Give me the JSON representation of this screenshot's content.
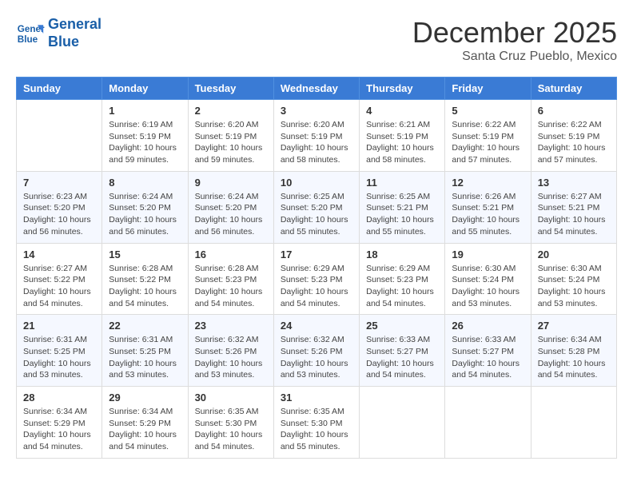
{
  "logo": {
    "line1": "General",
    "line2": "Blue"
  },
  "title": "December 2025",
  "location": "Santa Cruz Pueblo, Mexico",
  "days_header": [
    "Sunday",
    "Monday",
    "Tuesday",
    "Wednesday",
    "Thursday",
    "Friday",
    "Saturday"
  ],
  "weeks": [
    [
      {
        "num": "",
        "info": ""
      },
      {
        "num": "1",
        "info": "Sunrise: 6:19 AM\nSunset: 5:19 PM\nDaylight: 10 hours\nand 59 minutes."
      },
      {
        "num": "2",
        "info": "Sunrise: 6:20 AM\nSunset: 5:19 PM\nDaylight: 10 hours\nand 59 minutes."
      },
      {
        "num": "3",
        "info": "Sunrise: 6:20 AM\nSunset: 5:19 PM\nDaylight: 10 hours\nand 58 minutes."
      },
      {
        "num": "4",
        "info": "Sunrise: 6:21 AM\nSunset: 5:19 PM\nDaylight: 10 hours\nand 58 minutes."
      },
      {
        "num": "5",
        "info": "Sunrise: 6:22 AM\nSunset: 5:19 PM\nDaylight: 10 hours\nand 57 minutes."
      },
      {
        "num": "6",
        "info": "Sunrise: 6:22 AM\nSunset: 5:19 PM\nDaylight: 10 hours\nand 57 minutes."
      }
    ],
    [
      {
        "num": "7",
        "info": "Sunrise: 6:23 AM\nSunset: 5:20 PM\nDaylight: 10 hours\nand 56 minutes."
      },
      {
        "num": "8",
        "info": "Sunrise: 6:24 AM\nSunset: 5:20 PM\nDaylight: 10 hours\nand 56 minutes."
      },
      {
        "num": "9",
        "info": "Sunrise: 6:24 AM\nSunset: 5:20 PM\nDaylight: 10 hours\nand 56 minutes."
      },
      {
        "num": "10",
        "info": "Sunrise: 6:25 AM\nSunset: 5:20 PM\nDaylight: 10 hours\nand 55 minutes."
      },
      {
        "num": "11",
        "info": "Sunrise: 6:25 AM\nSunset: 5:21 PM\nDaylight: 10 hours\nand 55 minutes."
      },
      {
        "num": "12",
        "info": "Sunrise: 6:26 AM\nSunset: 5:21 PM\nDaylight: 10 hours\nand 55 minutes."
      },
      {
        "num": "13",
        "info": "Sunrise: 6:27 AM\nSunset: 5:21 PM\nDaylight: 10 hours\nand 54 minutes."
      }
    ],
    [
      {
        "num": "14",
        "info": "Sunrise: 6:27 AM\nSunset: 5:22 PM\nDaylight: 10 hours\nand 54 minutes."
      },
      {
        "num": "15",
        "info": "Sunrise: 6:28 AM\nSunset: 5:22 PM\nDaylight: 10 hours\nand 54 minutes."
      },
      {
        "num": "16",
        "info": "Sunrise: 6:28 AM\nSunset: 5:23 PM\nDaylight: 10 hours\nand 54 minutes."
      },
      {
        "num": "17",
        "info": "Sunrise: 6:29 AM\nSunset: 5:23 PM\nDaylight: 10 hours\nand 54 minutes."
      },
      {
        "num": "18",
        "info": "Sunrise: 6:29 AM\nSunset: 5:23 PM\nDaylight: 10 hours\nand 54 minutes."
      },
      {
        "num": "19",
        "info": "Sunrise: 6:30 AM\nSunset: 5:24 PM\nDaylight: 10 hours\nand 53 minutes."
      },
      {
        "num": "20",
        "info": "Sunrise: 6:30 AM\nSunset: 5:24 PM\nDaylight: 10 hours\nand 53 minutes."
      }
    ],
    [
      {
        "num": "21",
        "info": "Sunrise: 6:31 AM\nSunset: 5:25 PM\nDaylight: 10 hours\nand 53 minutes."
      },
      {
        "num": "22",
        "info": "Sunrise: 6:31 AM\nSunset: 5:25 PM\nDaylight: 10 hours\nand 53 minutes."
      },
      {
        "num": "23",
        "info": "Sunrise: 6:32 AM\nSunset: 5:26 PM\nDaylight: 10 hours\nand 53 minutes."
      },
      {
        "num": "24",
        "info": "Sunrise: 6:32 AM\nSunset: 5:26 PM\nDaylight: 10 hours\nand 53 minutes."
      },
      {
        "num": "25",
        "info": "Sunrise: 6:33 AM\nSunset: 5:27 PM\nDaylight: 10 hours\nand 54 minutes."
      },
      {
        "num": "26",
        "info": "Sunrise: 6:33 AM\nSunset: 5:27 PM\nDaylight: 10 hours\nand 54 minutes."
      },
      {
        "num": "27",
        "info": "Sunrise: 6:34 AM\nSunset: 5:28 PM\nDaylight: 10 hours\nand 54 minutes."
      }
    ],
    [
      {
        "num": "28",
        "info": "Sunrise: 6:34 AM\nSunset: 5:29 PM\nDaylight: 10 hours\nand 54 minutes."
      },
      {
        "num": "29",
        "info": "Sunrise: 6:34 AM\nSunset: 5:29 PM\nDaylight: 10 hours\nand 54 minutes."
      },
      {
        "num": "30",
        "info": "Sunrise: 6:35 AM\nSunset: 5:30 PM\nDaylight: 10 hours\nand 54 minutes."
      },
      {
        "num": "31",
        "info": "Sunrise: 6:35 AM\nSunset: 5:30 PM\nDaylight: 10 hours\nand 55 minutes."
      },
      {
        "num": "",
        "info": ""
      },
      {
        "num": "",
        "info": ""
      },
      {
        "num": "",
        "info": ""
      }
    ]
  ]
}
